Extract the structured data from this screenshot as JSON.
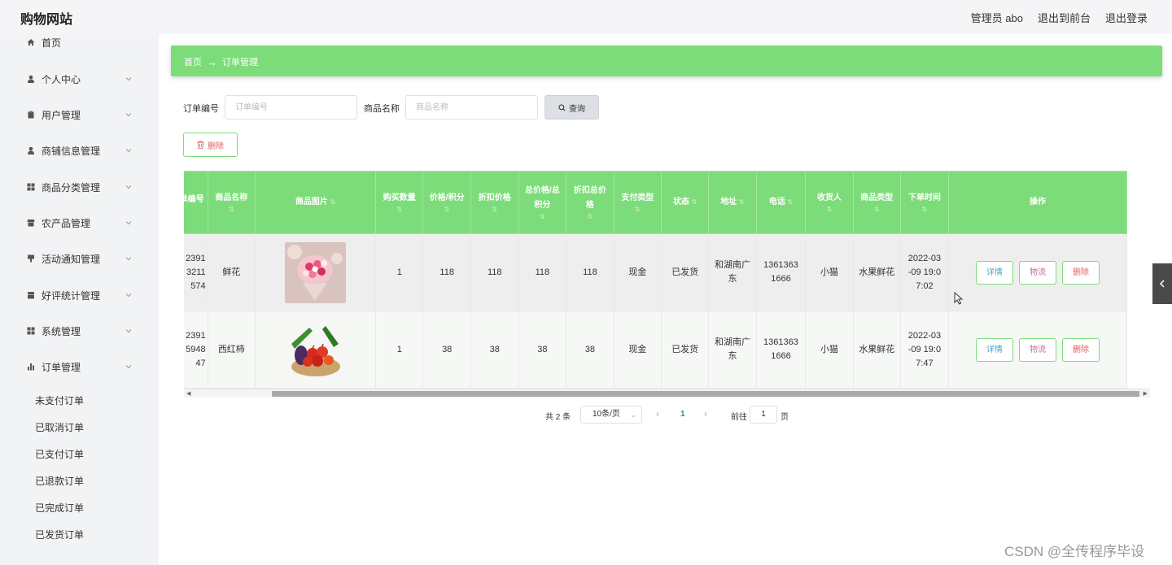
{
  "header": {
    "site_title": "购物网站",
    "admin_label": "管理员 abo",
    "front_label": "退出到前台",
    "logout_label": "退出登录"
  },
  "sidebar": {
    "items": [
      {
        "label": "首页",
        "icon": "home-icon"
      },
      {
        "label": "个人中心",
        "icon": "user-icon"
      },
      {
        "label": "用户管理",
        "icon": "clipboard-icon"
      },
      {
        "label": "商铺信息管理",
        "icon": "user-icon"
      },
      {
        "label": "商品分类管理",
        "icon": "grid-icon"
      },
      {
        "label": "农产品管理",
        "icon": "shop-icon"
      },
      {
        "label": "活动通知管理",
        "icon": "cup-icon"
      },
      {
        "label": "好评统计管理",
        "icon": "box-icon"
      },
      {
        "label": "系统管理",
        "icon": "grid-icon"
      },
      {
        "label": "订单管理",
        "icon": "bar-chart-icon"
      }
    ],
    "sub_items": [
      "未支付订单",
      "已取消订单",
      "已支付订单",
      "已退款订单",
      "已完成订单",
      "已发货订单"
    ]
  },
  "breadcrumb": {
    "home": "首页",
    "arrow": "→",
    "current": "订单管理"
  },
  "search": {
    "order_no_label": "订单编号",
    "order_no_placeholder": "订单编号",
    "product_label": "商品名称",
    "product_placeholder": "商品名称",
    "query_label": "查询"
  },
  "toolbar": {
    "delete_label": "删除"
  },
  "table": {
    "headers": [
      "订单编号",
      "商品名称",
      "商品图片",
      "购买数量",
      "价格/积分",
      "折扣价格",
      "总价格/总积分",
      "折扣总价格",
      "支付类型",
      "状态",
      "地址",
      "电话",
      "收货人",
      "商品类型",
      "下单时间",
      "操作"
    ],
    "rows": [
      {
        "order_no": "2391\n3211\n574",
        "order_no_lines": [
          "2391",
          "3211",
          "574"
        ],
        "product": "鲜花",
        "image": "flower-bouquet",
        "qty": "1",
        "price": "118",
        "discount_price": "118",
        "total": "118",
        "discount_total": "118",
        "pay_type": "现金",
        "status": "已发货",
        "address_lines": [
          "和湖南广",
          "东"
        ],
        "phone_lines": [
          "1361363",
          "1666"
        ],
        "receiver": "小猫",
        "type": "水果鲜花",
        "time_lines": [
          "2022-03",
          "-09 19:0",
          "7:02"
        ]
      },
      {
        "order_no_lines": [
          "2391",
          "5948",
          "47"
        ],
        "product": "西红柿",
        "image": "vegetables-basket",
        "qty": "1",
        "price": "38",
        "discount_price": "38",
        "total": "38",
        "discount_total": "38",
        "pay_type": "现金",
        "status": "已发货",
        "address_lines": [
          "和湖南广",
          "东"
        ],
        "phone_lines": [
          "1361363",
          "1666"
        ],
        "receiver": "小猫",
        "type": "水果鲜花",
        "time_lines": [
          "2022-03",
          "-09 19:0",
          "7:47"
        ]
      }
    ],
    "actions": {
      "detail": "详情",
      "logistics": "物流",
      "delete": "删除"
    }
  },
  "pagination": {
    "total": "共 2 条",
    "page_size": "10条/页",
    "current_page": "1",
    "goto_label": "前往",
    "goto_value": "1",
    "page_suffix": "页"
  },
  "watermark": "CSDN @全传程序毕设",
  "colors": {
    "accent": "#7ddc7a",
    "danger": "#e06060",
    "detail": "#4aa3c9",
    "logistics": "#c76aa0"
  }
}
